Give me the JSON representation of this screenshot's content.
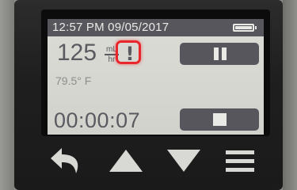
{
  "status_bar": {
    "datetime": "12:57 PM 09/05/2017",
    "battery_level": 1.0
  },
  "rate": {
    "value": "125",
    "unit_top": "mL",
    "unit_bottom": "hr",
    "alert_symbol": "!"
  },
  "temperature": "79.5° F",
  "timer": "00:00:07",
  "buttons": {
    "pause": "pause-icon",
    "stop": "stop-icon"
  },
  "hardware_buttons": [
    "back-arrow-icon",
    "up-arrow-icon",
    "down-arrow-icon",
    "menu-icon"
  ],
  "colors": {
    "screen_bg": "#d6d6d0",
    "accent_dark": "#56565c",
    "alert_red": "#e8262c",
    "icon_light": "#e9e9e6"
  }
}
